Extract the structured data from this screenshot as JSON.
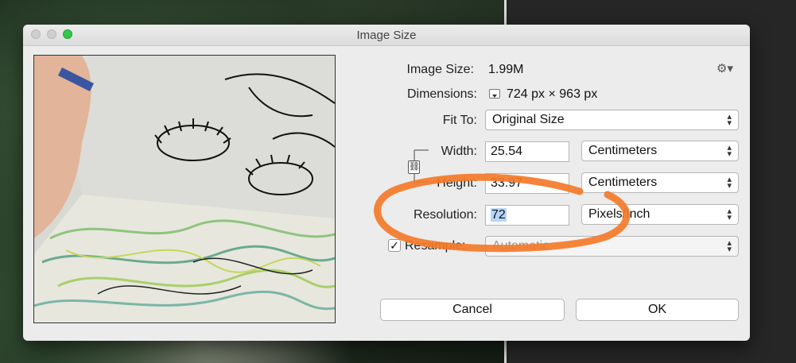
{
  "window": {
    "title": "Image Size"
  },
  "info": {
    "image_size_label": "Image Size:",
    "image_size_value": "1.99M",
    "dimensions_label": "Dimensions:",
    "dimensions_value": "724 px  ×  963 px"
  },
  "fit_to": {
    "label": "Fit To:",
    "value": "Original Size"
  },
  "width": {
    "label": "Width:",
    "value": "25.54",
    "unit": "Centimeters"
  },
  "height": {
    "label": "Height:",
    "value": "33.97",
    "unit": "Centimeters"
  },
  "resolution": {
    "label": "Resolution:",
    "value": "72",
    "unit": "Pixels/Inch"
  },
  "resample": {
    "label": "Resample:",
    "value": "Automatic",
    "checked": true
  },
  "buttons": {
    "cancel": "Cancel",
    "ok": "OK"
  },
  "colors": {
    "annotation": "#f47a2a",
    "selection": "#b4d6fb"
  },
  "icons": [
    "gear-icon",
    "dropdown-triangle-icon",
    "chain-link-icon",
    "checkmark-icon"
  ]
}
